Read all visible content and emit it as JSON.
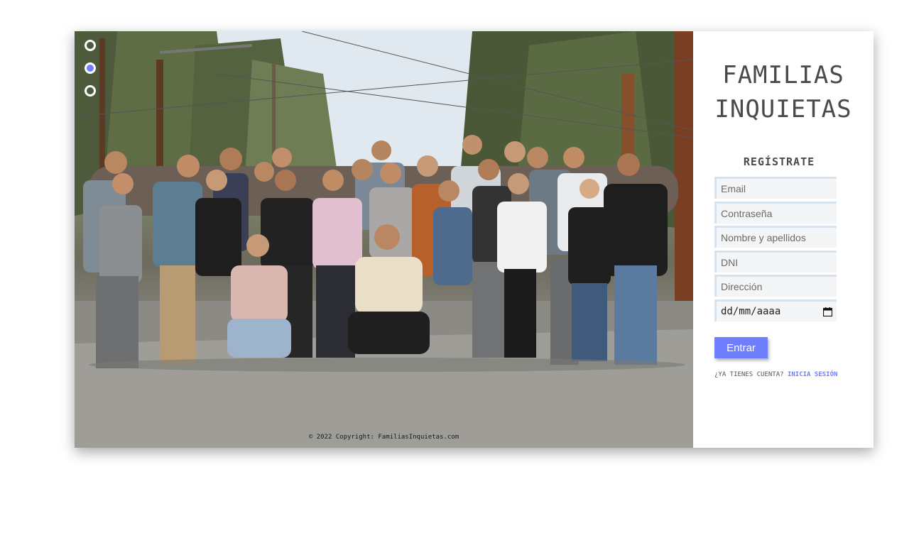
{
  "brand": {
    "line1": "FAMILIAS",
    "line2": "INQUIETAS"
  },
  "carousel": {
    "dots": [
      "slide-1",
      "slide-2",
      "slide-3"
    ],
    "active_index": 1,
    "copyright": "© 2022 Copyright: FamiliasInquietas.com"
  },
  "form": {
    "title": "REGÍSTRATE",
    "email_placeholder": "Email",
    "password_placeholder": "Contraseña",
    "name_placeholder": "Nombre y apellidos",
    "dni_placeholder": "DNI",
    "address_placeholder": "Dirección",
    "date_placeholder": "dd/mm/aaaa",
    "submit_label": "Entrar",
    "login_prompt": "¿YA TIENES CUENTA?",
    "login_link": "INICIA SESIÓN"
  },
  "colors": {
    "accent": "#6e7eff",
    "text_dark": "#4a4a4a"
  }
}
